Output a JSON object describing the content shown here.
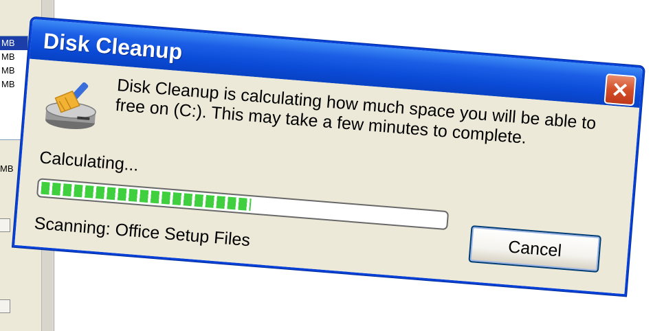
{
  "background_window": {
    "sizes": [
      "MB",
      "MB",
      "MB",
      "MB"
    ],
    "label": "MB"
  },
  "dialog": {
    "title": "Disk Cleanup",
    "close_label": "✕",
    "icon": "disk-cleanup-icon",
    "message": "Disk Cleanup is calculating how much space you will be able to free on  (C:). This may take a few minutes to complete.",
    "status": "Calculating...",
    "progress_fraction": 0.52,
    "scanning_label": "Scanning:",
    "scanning_item": "Office Setup Files",
    "cancel_label": "Cancel"
  },
  "colors": {
    "titlebar": "#0a4ad6",
    "progress": "#3fcf3f",
    "close_button": "#d34f2a"
  }
}
